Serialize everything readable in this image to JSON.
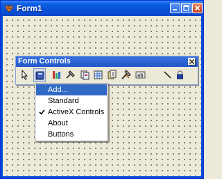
{
  "window": {
    "title": "Form1",
    "controls": [
      "minimize-icon",
      "maximize-icon",
      "close-icon"
    ]
  },
  "form_controls": {
    "title": "Form Controls",
    "tools": [
      "select-pointer-icon",
      "book-icon",
      "properties-icon",
      "tools-icon",
      "pages-icon",
      "grid-icon",
      "pages2-icon",
      "tools2-icon",
      "text-box-icon",
      "line-icon",
      "lock-icon"
    ]
  },
  "menu": {
    "items": [
      {
        "label": "Add...",
        "selected": true,
        "checked": false
      },
      {
        "label": "Standard",
        "selected": false,
        "checked": false
      },
      {
        "label": "ActiveX Controls",
        "selected": false,
        "checked": true
      },
      {
        "label": "About",
        "selected": false,
        "checked": false
      },
      {
        "label": "Buttons",
        "selected": false,
        "checked": false
      }
    ]
  },
  "colors": {
    "titlebar": "#0a54d8",
    "menu_highlight": "#316ac5",
    "face": "#ece9d8"
  }
}
